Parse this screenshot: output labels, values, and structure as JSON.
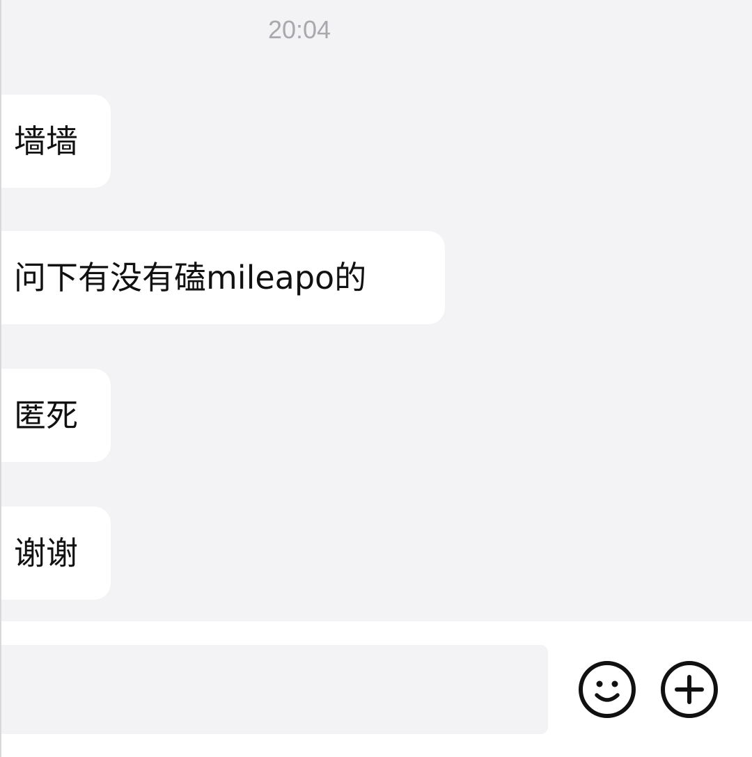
{
  "chat": {
    "timestamp": "20:04",
    "messages": [
      {
        "text": "墙墙"
      },
      {
        "text": "问下有没有磕mileapo的"
      },
      {
        "text": "匿死"
      },
      {
        "text": "谢谢"
      }
    ]
  },
  "input_bar": {
    "input_value": "",
    "icons": [
      "smiley-icon",
      "plus-circle-icon"
    ]
  },
  "colors": {
    "background": "#f3f2f5",
    "bubble": "#ffffff",
    "timestamp": "#a9a9ad",
    "text": "#111111"
  }
}
